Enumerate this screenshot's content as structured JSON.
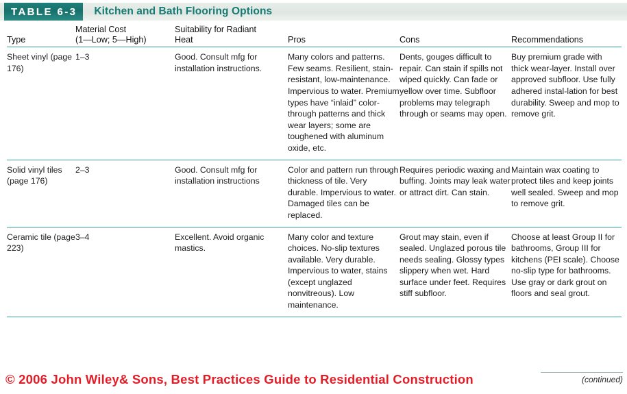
{
  "header": {
    "badge_label": "TABLE 6-3",
    "title": "Kitchen and Bath Flooring Options",
    "badge_color": "#1f7f78",
    "title_color": "#177a73",
    "rule_color": "#3aa396"
  },
  "table": {
    "columns": [
      {
        "line1": "",
        "line2": "Type"
      },
      {
        "line1": "Material Cost",
        "line2": "(1—Low; 5—High)"
      },
      {
        "line1": "Suitability for Radiant",
        "line2": "Heat"
      },
      {
        "line1": "",
        "line2": "Pros"
      },
      {
        "line1": "",
        "line2": "Cons"
      },
      {
        "line1": "",
        "line2": "Recommendations"
      }
    ],
    "rows": [
      {
        "type": "Sheet vinyl (page 176)",
        "cost": "1–3",
        "suitability": "Good. Consult mfg for installation instructions.",
        "pros": "Many colors and patterns. Few seams. Resilient, stain-resistant, low-maintenance. Impervious to water. Premium types have “inlaid” color-through patterns and thick wear layers; some are toughened with aluminum oxide, etc.",
        "cons": "Dents, gouges difficult to repair. Can stain if spills not wiped quickly. Can fade or yellow over time. Subfloor problems may telegraph through or seams may open.",
        "recommendations": "Buy premium grade with thick wear-layer. Install over approved subfloor. Use fully adhered instal-lation for best durability. Sweep and mop to remove grit."
      },
      {
        "type": "Solid vinyl tiles (page 176)",
        "cost": "2–3",
        "suitability": "Good. Consult mfg for installation instructions",
        "pros": "Color and pattern run through thickness of tile. Very durable. Impervious to water. Damaged tiles can be replaced.",
        "cons": "Requires periodic waxing and buffing. Joints may leak water or attract dirt. Can stain.",
        "recommendations": "Maintain wax coating to protect tiles and keep joints well sealed. Sweep and mop to remove grit."
      },
      {
        "type": "Ceramic tile (page 223)",
        "cost": "3–4",
        "suitability": "Excellent. Avoid organic mastics.",
        "pros": "Many color and texture choices. No-slip textures available. Very durable. Impervious to water, stains (except unglazed nonvitreous). Low maintenance.",
        "cons": "Grout may stain, even if sealed. Unglazed porous tile needs sealing. Glossy types slippery when wet. Hard surface under feet. Requires stiff subfloor.",
        "recommendations": "Choose at least Group II for bathrooms, Group III for kitchens (PEI scale). Choose no-slip type for bathrooms. Use gray or dark grout on floors and seal grout."
      }
    ]
  },
  "footer": {
    "copyright": "© 2006 John Wiley& Sons, Best Practices Guide to Residential Construction",
    "continued": "(continued)",
    "copyright_color": "#e21d28"
  }
}
